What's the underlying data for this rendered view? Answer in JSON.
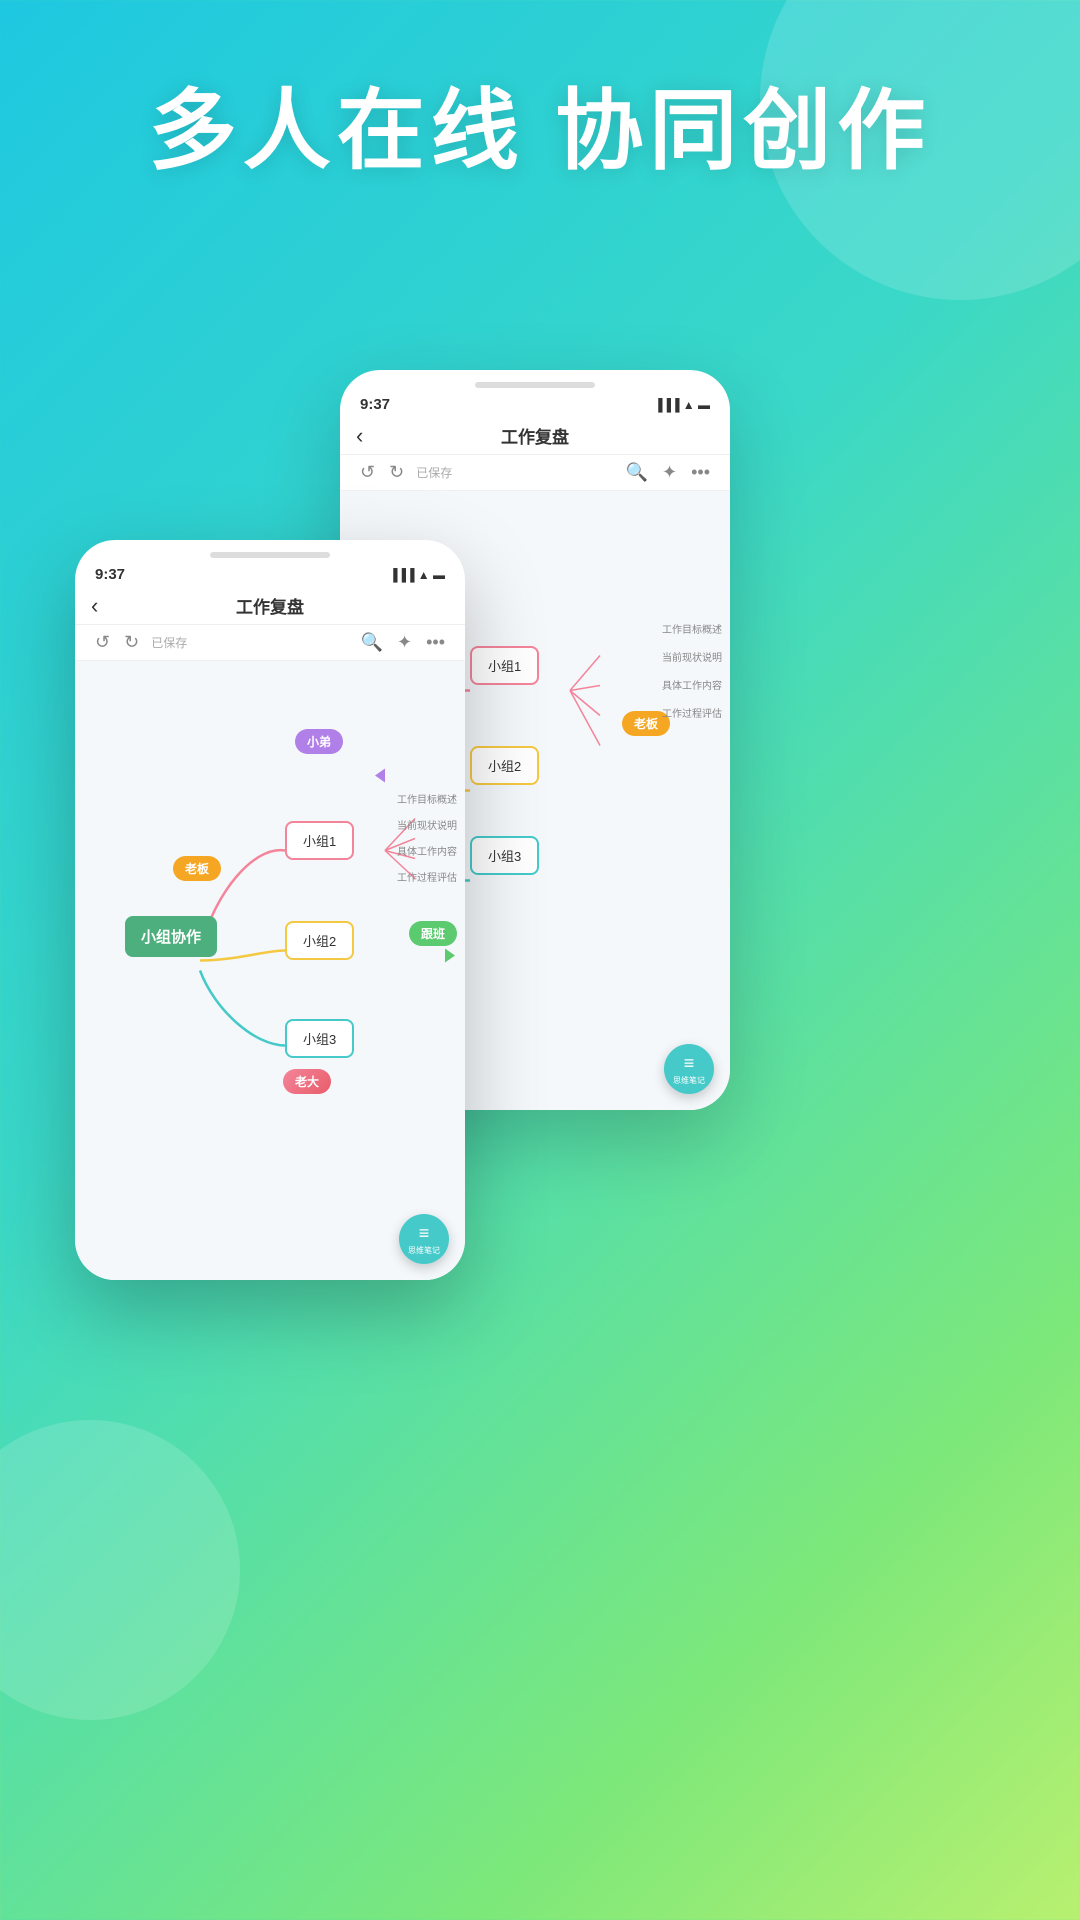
{
  "hero": {
    "line1": "多人在线 协同创作"
  },
  "phone_back": {
    "time": "9:37",
    "title": "工作复盘",
    "saved": "已保存",
    "nodes": {
      "group1": "小组1",
      "group2": "小组2",
      "group3": "小组3",
      "label_boss": "老板",
      "branch1": "工作目标概述",
      "branch2": "当前现状说明",
      "branch3": "具体工作内容",
      "branch4": "工作过程评估",
      "note": "思维笔记"
    }
  },
  "phone_front": {
    "time": "9:37",
    "title": "工作复盘",
    "saved": "已保存",
    "nodes": {
      "center": "小组协作",
      "group1": "小组1",
      "group2": "小组2",
      "group3": "小组3",
      "label_didi": "小弟",
      "label_boss": "老板",
      "label_gen": "跟班",
      "label_lao": "老大",
      "branch1": "工作目标概述",
      "branch2": "当前现状说明",
      "branch3": "具体工作内容",
      "branch4": "工作过程评估",
      "note": "思维笔记"
    }
  },
  "icons": {
    "back": "‹",
    "undo": "↺",
    "redo": "↻",
    "search": "🔍",
    "share": "✦",
    "more": "···",
    "note_icon": "≡"
  }
}
